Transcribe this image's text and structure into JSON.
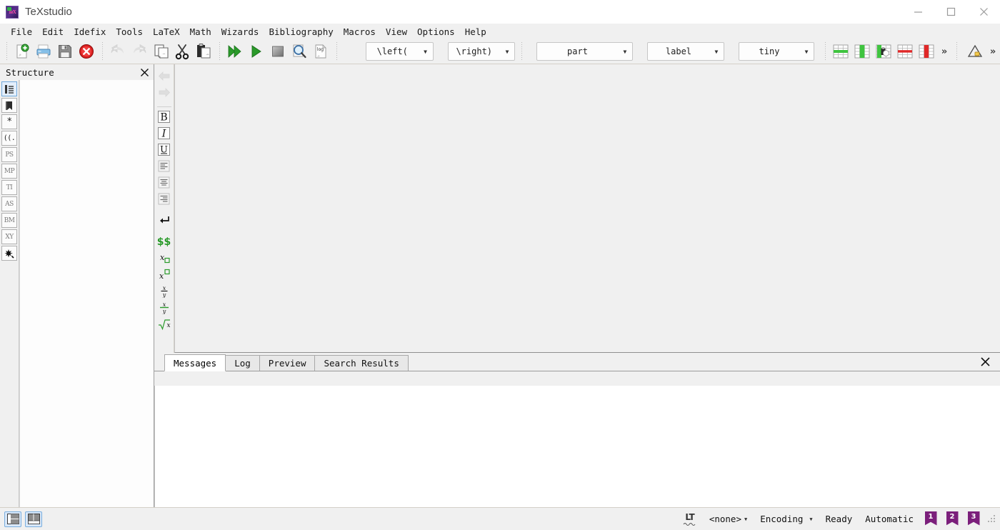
{
  "window": {
    "title": "TeXstudio",
    "app_icon": "texstudio-logo-icon",
    "controls": {
      "minimize": "minimize-icon",
      "maximize": "maximize-icon",
      "close": "close-icon"
    }
  },
  "menubar": {
    "items": [
      {
        "label": "File"
      },
      {
        "label": "Edit"
      },
      {
        "label": "Idefix"
      },
      {
        "label": "Tools"
      },
      {
        "label": "LaTeX"
      },
      {
        "label": "Math"
      },
      {
        "label": "Wizards"
      },
      {
        "label": "Bibliography"
      },
      {
        "label": "Macros"
      },
      {
        "label": "View"
      },
      {
        "label": "Options"
      },
      {
        "label": "Help"
      }
    ]
  },
  "toolbar": {
    "file_group": [
      {
        "name": "new-file-icon",
        "tooltip": "New"
      },
      {
        "name": "open-file-icon",
        "tooltip": "Open"
      },
      {
        "name": "save-file-icon",
        "tooltip": "Save"
      },
      {
        "name": "close-document-icon",
        "tooltip": "Close"
      }
    ],
    "edit_group": [
      {
        "name": "undo-icon",
        "tooltip": "Undo",
        "disabled": true
      },
      {
        "name": "redo-icon",
        "tooltip": "Redo",
        "disabled": true
      },
      {
        "name": "copy-icon",
        "tooltip": "Copy"
      },
      {
        "name": "cut-icon",
        "tooltip": "Cut"
      },
      {
        "name": "paste-icon",
        "tooltip": "Paste"
      }
    ],
    "build_group": [
      {
        "name": "build-and-view-icon",
        "tooltip": "Build & View"
      },
      {
        "name": "compile-icon",
        "tooltip": "Compile"
      },
      {
        "name": "stop-compile-icon",
        "tooltip": "Stop"
      },
      {
        "name": "view-pdf-icon",
        "tooltip": "View"
      },
      {
        "name": "view-log-icon",
        "tooltip": "Log"
      }
    ],
    "combos": [
      {
        "name": "left-delimiter-combo",
        "value": "\\left("
      },
      {
        "name": "right-delimiter-combo",
        "value": "\\right)"
      },
      {
        "name": "section-level-combo",
        "value": "part"
      },
      {
        "name": "reference-combo",
        "value": "label"
      },
      {
        "name": "font-size-combo",
        "value": "tiny"
      }
    ],
    "table_group": [
      {
        "name": "insert-row-icon",
        "tooltip": "Insert Row"
      },
      {
        "name": "insert-column-icon",
        "tooltip": "Insert Column"
      },
      {
        "name": "paste-column-icon",
        "tooltip": "Paste Column"
      },
      {
        "name": "delete-row-icon",
        "tooltip": "Delete Row"
      },
      {
        "name": "delete-column-icon",
        "tooltip": "Delete Column"
      }
    ],
    "overflow_1": "»",
    "math_group": [
      {
        "name": "math-assistant-icon",
        "tooltip": "Math Assistant"
      }
    ],
    "overflow_2": "»"
  },
  "structure_dock": {
    "title": "Structure",
    "close_icon": "close-icon",
    "rail": [
      {
        "name": "structure-view-icon",
        "label": "",
        "active": true
      },
      {
        "name": "bookmark-icon",
        "label": ""
      },
      {
        "name": "asterisk-icon",
        "label": "*"
      },
      {
        "name": "delimiter-icon",
        "label": "((."
      },
      {
        "name": "postscript-icon",
        "label": "PS"
      },
      {
        "name": "metapost-icon",
        "label": "MP"
      },
      {
        "name": "tikz-icon",
        "label": "TI"
      },
      {
        "name": "asymptote-icon",
        "label": "AS"
      },
      {
        "name": "bookmarks-icon",
        "label": "BM"
      },
      {
        "name": "xypic-icon",
        "label": "XY"
      },
      {
        "name": "magic-wand-icon",
        "label": ""
      }
    ]
  },
  "format_rail": {
    "items": [
      {
        "name": "nav-back-icon",
        "disabled": true
      },
      {
        "name": "nav-forward-icon",
        "disabled": true
      },
      {
        "name": "bold-icon",
        "label": "B"
      },
      {
        "name": "italic-icon",
        "label": "I"
      },
      {
        "name": "underline-icon",
        "label": "U"
      },
      {
        "name": "align-left-icon"
      },
      {
        "name": "align-center-icon"
      },
      {
        "name": "align-right-icon"
      },
      {
        "name": "newline-icon"
      },
      {
        "name": "math-mode-icon",
        "label": "$$"
      },
      {
        "name": "subscript-icon"
      },
      {
        "name": "superscript-icon"
      },
      {
        "name": "frac-icon"
      },
      {
        "name": "dfrac-icon"
      },
      {
        "name": "sqrt-icon"
      }
    ]
  },
  "bottom_panel": {
    "tabs": [
      {
        "label": "Messages",
        "active": true
      },
      {
        "label": "Log",
        "active": false
      },
      {
        "label": "Preview",
        "active": false
      },
      {
        "label": "Search Results",
        "active": false
      }
    ],
    "close_icon": "close-icon",
    "content": ""
  },
  "statusbar": {
    "layout_buttons": [
      {
        "name": "toggle-structure-panel-button",
        "active": true
      },
      {
        "name": "toggle-output-panel-button",
        "active": true
      }
    ],
    "lt_icon": "languagetool-icon",
    "lt_label": "LT",
    "language": "<none>",
    "encoding": "Encoding",
    "state": "Ready",
    "mode": "Automatic",
    "bookmarks": [
      {
        "name": "bookmark-1-badge",
        "number": "1"
      },
      {
        "name": "bookmark-2-badge",
        "number": "2"
      },
      {
        "name": "bookmark-3-badge",
        "number": "3"
      }
    ],
    "resize_grip": "resize-grip-icon"
  },
  "colors": {
    "window_bg": "#f0f0f0",
    "editor_bg": "#f0f0f0",
    "panel_bg": "#ffffff",
    "accent_green": "#2a9a2a",
    "accent_red": "#d03030",
    "bookmark_purple": "#7b1f7b",
    "title_text": "#4a4a4a"
  }
}
